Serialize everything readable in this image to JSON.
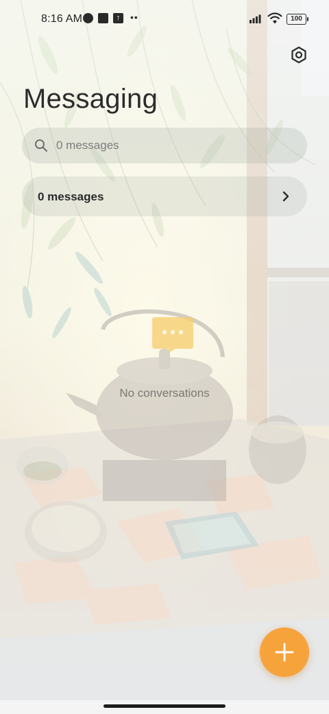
{
  "status_bar": {
    "time": "8:16 AM",
    "battery": "100",
    "icons": [
      "app-notification-icon",
      "square-notification-icon",
      "upload-icon",
      "more-dots-icon",
      "signal-icon",
      "wifi-icon",
      "battery-icon"
    ]
  },
  "header": {
    "title": "Messaging",
    "settings_icon": "settings-icon"
  },
  "search": {
    "placeholder": "0 messages",
    "icon": "search-icon"
  },
  "messages_row": {
    "label": "0 messages",
    "icon": "chevron-right-icon"
  },
  "empty_state": {
    "text": "No conversations",
    "icon": "chat-bubble-icon"
  },
  "fab": {
    "icon": "plus-icon"
  },
  "colors": {
    "accent": "#f7a33c",
    "empty_icon": "#f5cc6a",
    "text_primary": "#2c2c2c",
    "text_secondary": "#7a7a72"
  }
}
